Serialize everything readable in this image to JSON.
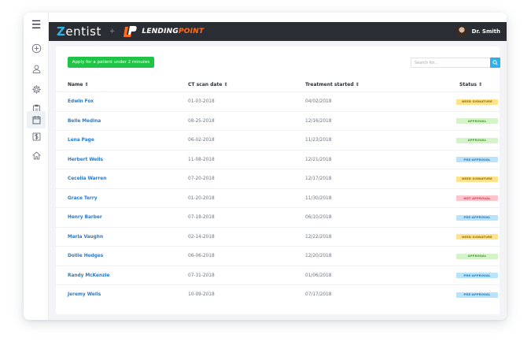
{
  "brand": {
    "zentist_initial": "Z",
    "zentist_rest": "entist",
    "plus": "+",
    "lending": "LENDING",
    "point": "POINT"
  },
  "user": {
    "name": "Dr. Smith"
  },
  "sidebar": {
    "menu_icon": "hamburger-icon",
    "items": [
      {
        "icon": "plus-circle-icon"
      },
      {
        "icon": "user-icon"
      },
      {
        "icon": "gear-icon"
      },
      {
        "icon": "clipboard-icon"
      },
      {
        "icon": "calendar-icon",
        "active": true
      },
      {
        "icon": "dollar-icon"
      },
      {
        "icon": "home-icon"
      }
    ]
  },
  "toolbar": {
    "apply_label": "Apply for a patient under 2 minutes",
    "search_placeholder": "Search for..."
  },
  "table": {
    "headers": {
      "name": "Name ⇕",
      "ct": "CT scan date ⇕",
      "treatment": "Treatment started ⇕",
      "status": "Status ⇕"
    },
    "rows": [
      {
        "name": "Edwin Fox",
        "ct": "01-03-2018",
        "treatment": "04/02/2018",
        "status": "NEED SIGNATURE",
        "kind": "need"
      },
      {
        "name": "Belle Medina",
        "ct": "08-25-2018",
        "treatment": "12/16/2018",
        "status": "APPROVAL",
        "kind": "approval"
      },
      {
        "name": "Lena Page",
        "ct": "06-02-2018",
        "treatment": "11/23/2018",
        "status": "APPROVAL",
        "kind": "approval"
      },
      {
        "name": "Herbert Wells",
        "ct": "11-08-2018",
        "treatment": "12/21/2018",
        "status": "PRE-APPROVAL",
        "kind": "pre"
      },
      {
        "name": "Cecelia Warren",
        "ct": "07-20-2018",
        "treatment": "12/17/2018",
        "status": "NEED SIGNATURE",
        "kind": "need"
      },
      {
        "name": "Grace Terry",
        "ct": "01-20-2018",
        "treatment": "11/30/2018",
        "status": "NOT APPROVAL",
        "kind": "not"
      },
      {
        "name": "Henry Barber",
        "ct": "07-18-2018",
        "treatment": "06/10/2018",
        "status": "PRE-APPROVAL",
        "kind": "pre"
      },
      {
        "name": "Maria Vaughn",
        "ct": "02-14-2018",
        "treatment": "12/22/2018",
        "status": "NEED SIGNATURE",
        "kind": "need"
      },
      {
        "name": "Dollie Hodges",
        "ct": "06-06-2018",
        "treatment": "12/20/2018",
        "status": "APPROVAL",
        "kind": "approval"
      },
      {
        "name": "Randy McKenzie",
        "ct": "07-31-2018",
        "treatment": "01/06/2018",
        "status": "PRE-APPROVAL",
        "kind": "pre"
      },
      {
        "name": "Jeremy Wells",
        "ct": "10-09-2018",
        "treatment": "07/17/2018",
        "status": "PRE-APPROVAL",
        "kind": "pre"
      }
    ]
  },
  "colors": {
    "topbar": "#2b2d34",
    "accent_blue": "#29b6e6",
    "primary_green": "#1fc447",
    "link_blue": "#2a79c5",
    "brand_orange": "#ff6b1a"
  }
}
